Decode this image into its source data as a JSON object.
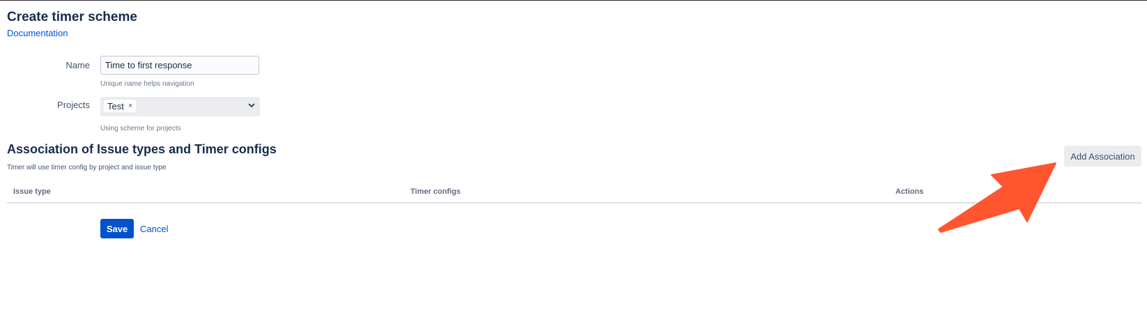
{
  "page": {
    "title": "Create timer scheme",
    "doc_link": "Documentation"
  },
  "form": {
    "name": {
      "label": "Name",
      "value": "Time to first response",
      "helper": "Unique name helps navigation"
    },
    "projects": {
      "label": "Projects",
      "tags": [
        "Test"
      ],
      "remove_glyph": "×",
      "helper": "Using scheme for projects"
    }
  },
  "association": {
    "title": "Association of Issue types and Timer configs",
    "description": "Timer will use timer config by project and issue type",
    "add_button": "Add Association",
    "columns": [
      "Issue type",
      "Timer configs",
      "Actions"
    ],
    "rows": []
  },
  "actions": {
    "save": "Save",
    "cancel": "Cancel"
  },
  "annotation": {
    "arrow_color": "#FF5630",
    "arrow_icon": "arrow-pointer-icon"
  },
  "colors": {
    "primary": "#0052CC",
    "text": "#172B4D",
    "subtle_bg": "#EBECF0"
  }
}
